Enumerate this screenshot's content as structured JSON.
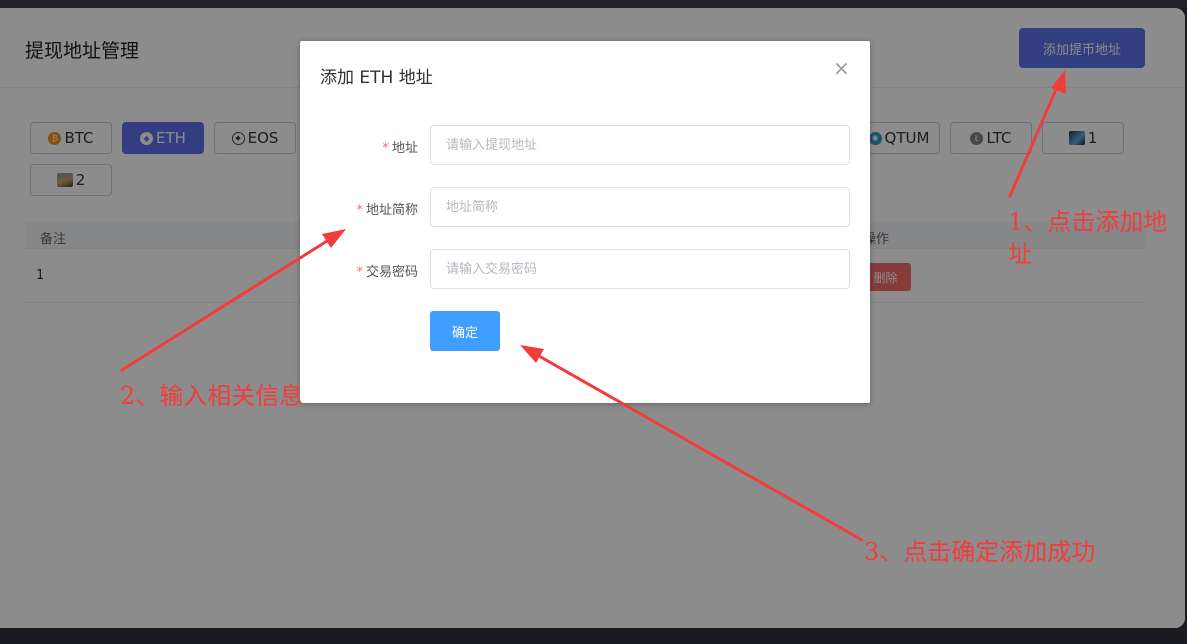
{
  "page": {
    "title": "提现地址管理",
    "add_button": "添加提币地址"
  },
  "coins": [
    {
      "label": "BTC",
      "icon": "btc-icon",
      "color": "#f7931a"
    },
    {
      "label": "ETH",
      "icon": "eth-icon",
      "color": "#627eea",
      "active": true
    },
    {
      "label": "EOS",
      "icon": "eos-icon",
      "color": "#444444"
    },
    {
      "label": "QTUM",
      "icon": "qtum-icon",
      "color": "#2e9ad0"
    },
    {
      "label": "LTC",
      "icon": "ltc-icon",
      "color": "#838383"
    },
    {
      "label": "1",
      "icon": "image-icon"
    },
    {
      "label": "2",
      "icon": "image-icon"
    }
  ],
  "table": {
    "headers": [
      "备注",
      "操作"
    ],
    "rows": [
      {
        "remark": "1",
        "action": "删除"
      }
    ]
  },
  "modal": {
    "title": "添加 ETH 地址",
    "close_icon": "close-icon",
    "fields": [
      {
        "label": "地址",
        "placeholder": "请输入提现地址"
      },
      {
        "label": "地址简称",
        "placeholder": "地址简称"
      },
      {
        "label": "交易密码",
        "placeholder": "请输入交易密码"
      }
    ],
    "required_mark": "*",
    "confirm": "确定"
  },
  "annotations": {
    "step1": "1、点击添加地址",
    "step2": "2、输入相关信息",
    "step3": "3、点击确定添加成功",
    "color": "#f23c3c"
  }
}
